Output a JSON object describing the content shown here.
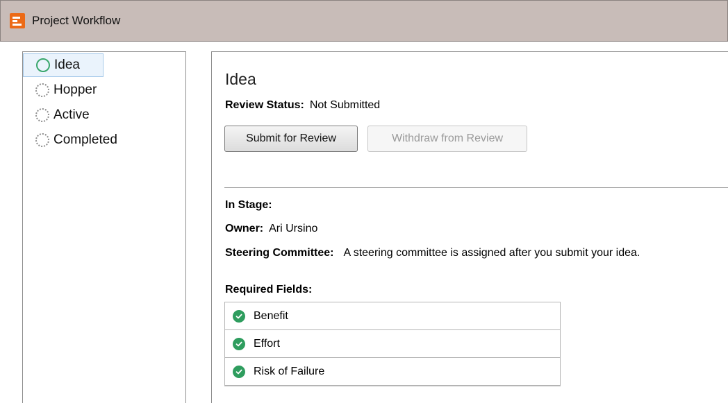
{
  "window": {
    "title": "Project Workflow",
    "icon": "workflow-icon",
    "accent_color": "#ec6a16"
  },
  "stages": [
    {
      "label": "Idea",
      "selected": true,
      "status": "current"
    },
    {
      "label": "Hopper",
      "selected": false,
      "status": "pending"
    },
    {
      "label": "Active",
      "selected": false,
      "status": "pending"
    },
    {
      "label": "Completed",
      "selected": false,
      "status": "pending"
    }
  ],
  "main": {
    "title": "Idea",
    "review_status": {
      "label": "Review Status:",
      "value": "Not Submitted"
    },
    "buttons": {
      "submit": "Submit for Review",
      "withdraw": "Withdraw from Review"
    },
    "in_stage": {
      "label": "In Stage:"
    },
    "owner": {
      "label": "Owner:",
      "value": "Ari Ursino"
    },
    "steering": {
      "label": "Steering Committee:",
      "value": "A steering committee is assigned after you submit your idea."
    },
    "required_fields": {
      "label": "Required Fields:",
      "items": [
        "Benefit",
        "Effort",
        "Risk of Failure"
      ]
    }
  },
  "colors": {
    "check_green": "#2e9d5e",
    "ring_green": "#3aa76d",
    "selection": "#eaf3fc"
  }
}
